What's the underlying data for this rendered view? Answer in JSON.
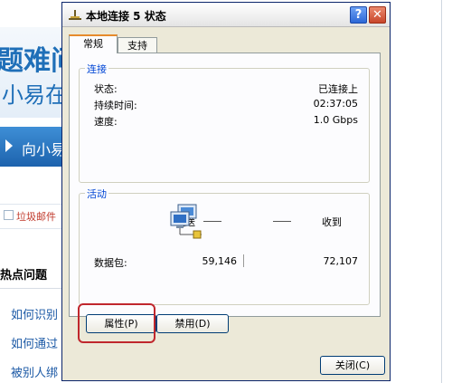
{
  "background_page": {
    "banner_big": "题难问",
    "banner_sub": "小易在",
    "nav_button": "向小易",
    "spam_label": "垃圾邮件",
    "hot_section": "热点问题",
    "links": [
      "如何识别",
      "如何通过",
      "被别人绑"
    ]
  },
  "dialog": {
    "title": "本地连接 5 状态",
    "help_label": "?",
    "close_icon_label": "✕",
    "tabs": [
      {
        "label": "常规"
      },
      {
        "label": "支持"
      }
    ],
    "connection": {
      "legend": "连接",
      "rows": [
        {
          "label": "状态:",
          "value": "已连接上"
        },
        {
          "label": "持续时间:",
          "value": "02:37:05"
        },
        {
          "label": "速度:",
          "value": "1.0 Gbps"
        }
      ]
    },
    "activity": {
      "legend": "活动",
      "sent_label": "发送",
      "received_label": "收到",
      "packets_label": "数据包:",
      "sent_value": "59,146",
      "received_value": "72,107"
    },
    "buttons": {
      "properties": "属性(P)",
      "disable": "禁用(D)",
      "close": "关闭(C)"
    }
  },
  "colors": {
    "legend_text": "#0046d5",
    "highlight": "#c0272d",
    "dialog_bg": "#ece9d8"
  }
}
